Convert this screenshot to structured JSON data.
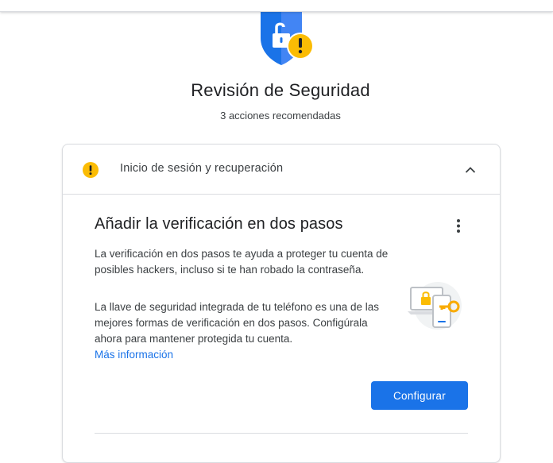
{
  "header": {
    "title": "Revisión de Seguridad",
    "subtitle": "3 acciones recomendadas"
  },
  "icons": {
    "hero": "shield-lock-warning-icon",
    "status": "warning-icon",
    "expand": "chevron-up-icon",
    "menu": "more-vert-icon",
    "illustration": "laptop-phone-key-icon"
  },
  "section": {
    "label": "Inicio de sesión y recuperación",
    "item": {
      "title": "Añadir la verificación en dos pasos",
      "paragraph1": "La verificación en dos pasos te ayuda a proteger tu cuenta de posibles hackers, incluso si te han robado la contraseña.",
      "paragraph2": "La llave de seguridad integrada de tu teléfono es una de las mejores formas de verificación en dos pasos. Configúrala ahora para mantener protegida tu cuenta.",
      "link": "Más información",
      "button": "Configurar"
    }
  },
  "colors": {
    "accent": "#1a73e8",
    "warning": "#fbbc04",
    "shield": "#4285f4"
  }
}
